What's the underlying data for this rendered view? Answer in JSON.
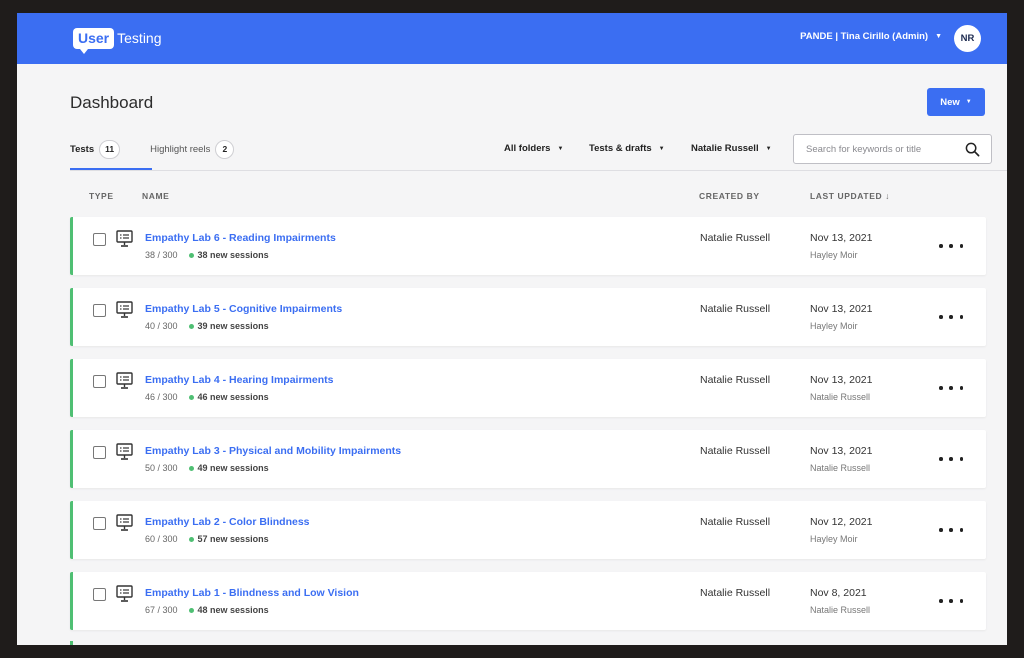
{
  "header": {
    "logo_box": "User",
    "logo_text": "Testing",
    "account_label": "PANDE | Tina Cirillo (Admin)",
    "avatar_initials": "NR",
    "brand_color": "#3b6ef2"
  },
  "page": {
    "title": "Dashboard",
    "new_button": "New"
  },
  "tabs": [
    {
      "label": "Tests",
      "count": "11",
      "active": true
    },
    {
      "label": "Highlight reels",
      "count": "2",
      "active": false
    }
  ],
  "filters": {
    "folders": "All folders",
    "type": "Tests & drafts",
    "owner": "Natalie Russell"
  },
  "search": {
    "placeholder": "Search for keywords or title",
    "value": ""
  },
  "columns": {
    "type": "TYPE",
    "name": "NAME",
    "created_by": "CREATED BY",
    "last_updated": "LAST UPDATED ↓"
  },
  "rows": [
    {
      "name": "Empathy Lab 6 - Reading Impairments",
      "progress": "38 / 300",
      "sessions": "38 new sessions",
      "created_by": "Natalie Russell",
      "date": "Nov 13, 2021",
      "updated_by": "Hayley Moir"
    },
    {
      "name": "Empathy Lab 5 - Cognitive Impairments",
      "progress": "40 / 300",
      "sessions": "39 new sessions",
      "created_by": "Natalie Russell",
      "date": "Nov 13, 2021",
      "updated_by": "Hayley Moir"
    },
    {
      "name": "Empathy Lab 4 - Hearing Impairments",
      "progress": "46 / 300",
      "sessions": "46 new sessions",
      "created_by": "Natalie Russell",
      "date": "Nov 13, 2021",
      "updated_by": "Natalie Russell"
    },
    {
      "name": "Empathy Lab 3 - Physical and Mobility Impairments",
      "progress": "50 / 300",
      "sessions": "49 new sessions",
      "created_by": "Natalie Russell",
      "date": "Nov 13, 2021",
      "updated_by": "Natalie Russell"
    },
    {
      "name": "Empathy Lab 2 - Color Blindness",
      "progress": "60 / 300",
      "sessions": "57 new sessions",
      "created_by": "Natalie Russell",
      "date": "Nov 12, 2021",
      "updated_by": "Hayley Moir"
    },
    {
      "name": "Empathy Lab 1 - Blindness and Low Vision",
      "progress": "67 / 300",
      "sessions": "48 new sessions",
      "created_by": "Natalie Russell",
      "date": "Nov 8, 2021",
      "updated_by": "Natalie Russell"
    }
  ],
  "status_color": "#4fbf73"
}
